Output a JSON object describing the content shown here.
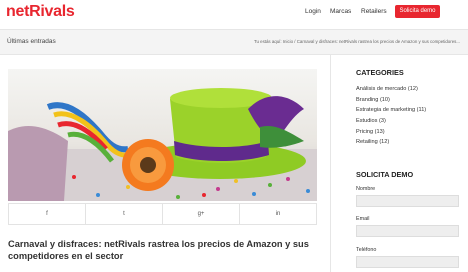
{
  "header": {
    "logo": "netRivals",
    "nav": [
      "Login",
      "Marcas",
      "Retailers"
    ],
    "cta": "Solicita demo"
  },
  "subheader": {
    "title": "Últimas entradas",
    "breadcrumb": "Tu estás aquí:  Inicio  /  Carnaval y disfraces: netRivals rastrea los precios de Amazon y sus competidores..."
  },
  "post": {
    "title": "Carnaval y disfraces: netRivals rastrea los precios de Amazon y sus competidores en el sector",
    "share": [
      {
        "icon": "facebook-icon",
        "glyph": "f"
      },
      {
        "icon": "twitter-icon",
        "glyph": "t"
      },
      {
        "icon": "google-plus-icon",
        "glyph": "g+"
      },
      {
        "icon": "linkedin-icon",
        "glyph": "in"
      }
    ]
  },
  "sidebar": {
    "categories_title": "CATEGORIES",
    "categories": [
      "Análisis de mercado (12)",
      "Branding (10)",
      "Estrategia de marketing (11)",
      "Estudios (3)",
      "Pricing (13)",
      "Retailing (12)"
    ],
    "demo_title": "SOLICITA DEMO",
    "fields": [
      "Nombre",
      "Email",
      "Teléfono"
    ]
  },
  "colors": {
    "brand": "#e8262f",
    "hat": "#9bd22a",
    "flower": "#f47a1f",
    "ribbon": "#6a2c91"
  }
}
